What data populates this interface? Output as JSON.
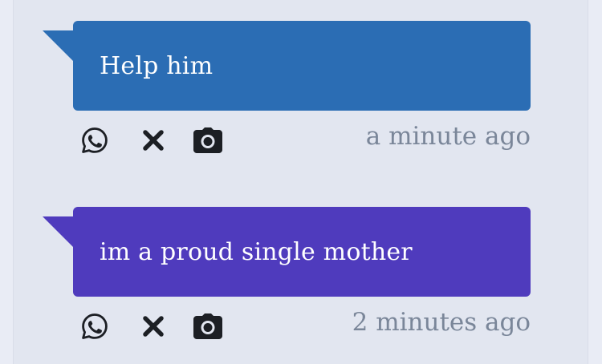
{
  "colors": {
    "page_background": "#e9ecf5",
    "panel_background": "#e2e6f0",
    "bubble_blue": "#2b6db4",
    "bubble_purple": "#4f3bbd",
    "timestamp_text": "#7a8699",
    "icon_color": "#1c1f24"
  },
  "messages": [
    {
      "text": "Help him",
      "timestamp": "a minute ago",
      "bubble_color": "blue",
      "actions": [
        "whatsapp-icon",
        "x-icon",
        "camera-icon"
      ]
    },
    {
      "text": "im a proud single mother",
      "timestamp": "2 minutes ago",
      "bubble_color": "purple",
      "actions": [
        "whatsapp-icon",
        "x-icon",
        "camera-icon"
      ]
    }
  ]
}
